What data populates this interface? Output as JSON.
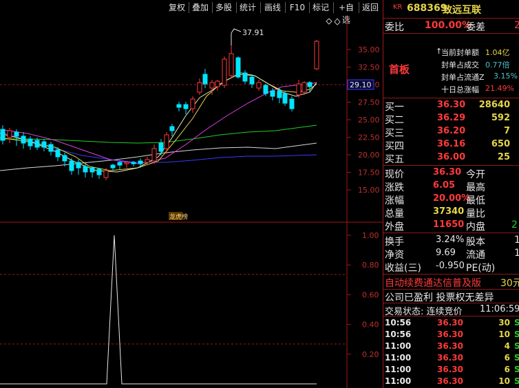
{
  "toolbar": {
    "buttons": [
      "复权",
      "叠加",
      "多股",
      "统计",
      "画线",
      "F10",
      "标记",
      "+自选",
      "返回"
    ]
  },
  "header": {
    "market": "KR",
    "code": "688369",
    "name": "致远互联"
  },
  "order_ratio": {
    "label": "委比",
    "value": "100.00%",
    "diff_label": "委差",
    "diff_value": "2"
  },
  "limit_info": {
    "tag": "首板",
    "rows": [
      {
        "label": "当前封单额",
        "value": "1.04亿"
      },
      {
        "label": "封单占成交",
        "value": "0.77倍"
      },
      {
        "label": "封单占流通Z",
        "value": "3.15%"
      },
      {
        "label": "十日总涨幅",
        "value": "21.49%"
      }
    ]
  },
  "bids": [
    {
      "label": "买一",
      "price": "36.30",
      "vol": "28640"
    },
    {
      "label": "买二",
      "price": "36.29",
      "vol": "592"
    },
    {
      "label": "买三",
      "price": "36.20",
      "vol": "7"
    },
    {
      "label": "买四",
      "price": "36.16",
      "vol": "650"
    },
    {
      "label": "买五",
      "price": "36.00",
      "vol": "25"
    }
  ],
  "quote": [
    {
      "l1": "现价",
      "v1": "36.30",
      "l2": "今开",
      "v2": ""
    },
    {
      "l1": "涨跌",
      "v1": "6.05",
      "l2": "最高",
      "v2": ""
    },
    {
      "l1": "涨幅",
      "v1": "20.00%",
      "l2": "最低",
      "v2": ""
    },
    {
      "l1": "总量",
      "v1": "37340",
      "l2": "量比",
      "v2": ""
    },
    {
      "l1": "外盘",
      "v1": "11650",
      "l2": "内盘",
      "v2": "2"
    }
  ],
  "fundamentals": [
    {
      "l1": "换手",
      "v1": "3.24%",
      "l2": "股本",
      "v2": "1"
    },
    {
      "l1": "净资",
      "v1": "9.69",
      "l2": "流通",
      "v2": "1"
    },
    {
      "l1": "收益(三)",
      "v1": "-0.950",
      "l2": "PE(动)",
      "v2": ""
    }
  ],
  "promo": {
    "text": "自动续费通达信普及版",
    "price": "30元"
  },
  "notice": "公司已盈利 投票权无差异",
  "trade_status": {
    "label": "交易状态: 连续竞价",
    "time": "11:06:59"
  },
  "ticks": [
    {
      "time": "10:56",
      "price": "36.30",
      "vol": "30",
      "side": "S"
    },
    {
      "time": "10:56",
      "price": "36.30",
      "vol": "10",
      "side": "S"
    },
    {
      "time": "11:00",
      "price": "36.30",
      "vol": "4",
      "side": "S"
    },
    {
      "time": "11:00",
      "price": "36.30",
      "vol": "6",
      "side": "S"
    },
    {
      "time": "11:00",
      "price": "36.30",
      "vol": "6",
      "side": "S"
    },
    {
      "time": "11:00",
      "price": "36.30",
      "vol": "10",
      "side": "S"
    }
  ],
  "chart": {
    "high_label": "37.91",
    "current_price_label": "29.10",
    "marker_label": "龙虎榜",
    "price_ticks": [
      "35.00",
      "32.50",
      "30.00",
      "27.50",
      "25.00",
      "22.50",
      "20.00",
      "17.50",
      "15.00"
    ],
    "ind_ticks": [
      "1.00",
      "0.80",
      "0.60",
      "0.40",
      "0.20"
    ]
  },
  "chart_data": {
    "type": "candlestick",
    "price_axis": {
      "ticks": [
        35.0,
        32.5,
        30.0,
        27.5,
        25.0,
        22.5,
        20.0,
        17.5,
        15.0
      ]
    },
    "indicator_axis": {
      "ticks": [
        1.0,
        0.8,
        0.6,
        0.4,
        0.2
      ]
    },
    "colors": {
      "up": "#ff3a3a",
      "down": "#00e5ff",
      "ma1": "#e8e8e8",
      "ma2": "#e6d64a",
      "ma3": "#e040e0",
      "ma4": "#22d022",
      "ma5": "#3a3aff"
    }
  }
}
